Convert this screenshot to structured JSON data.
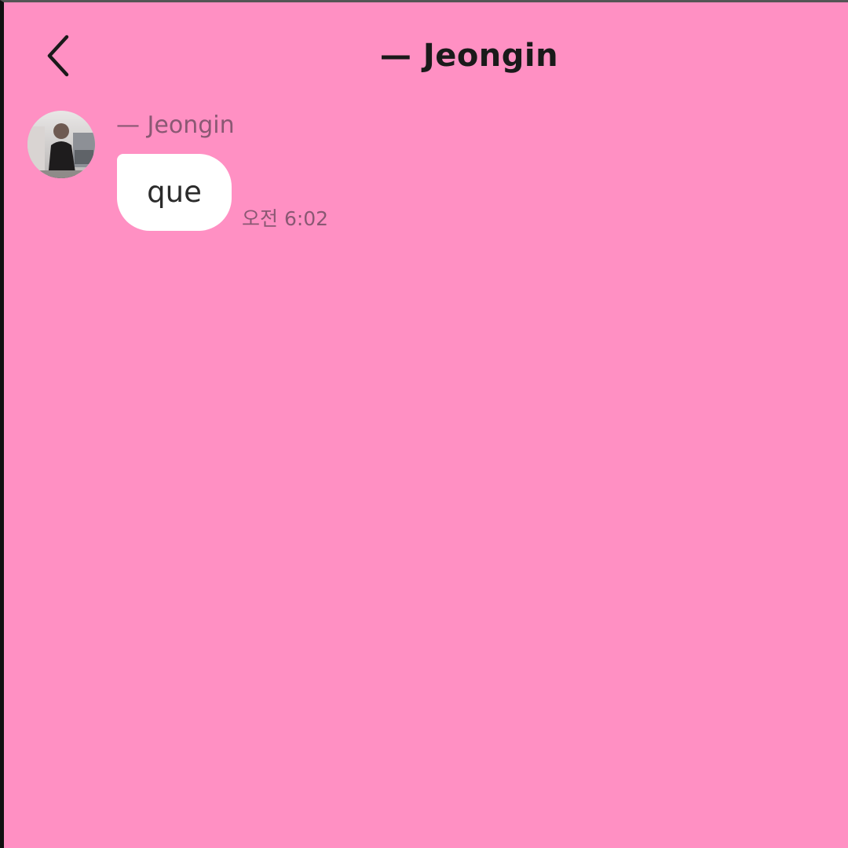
{
  "header": {
    "back_icon": "chevron-left-icon",
    "title": "— Jeongin"
  },
  "messages": [
    {
      "sender": "— Jeongin",
      "avatar_icon": "profile-photo",
      "text": "que",
      "time": "오전 6:02"
    }
  ],
  "colors": {
    "background": "#ff90c3",
    "bubble": "#ffffff",
    "title_text": "#1a1a1a",
    "secondary_text": "#8a5873"
  }
}
